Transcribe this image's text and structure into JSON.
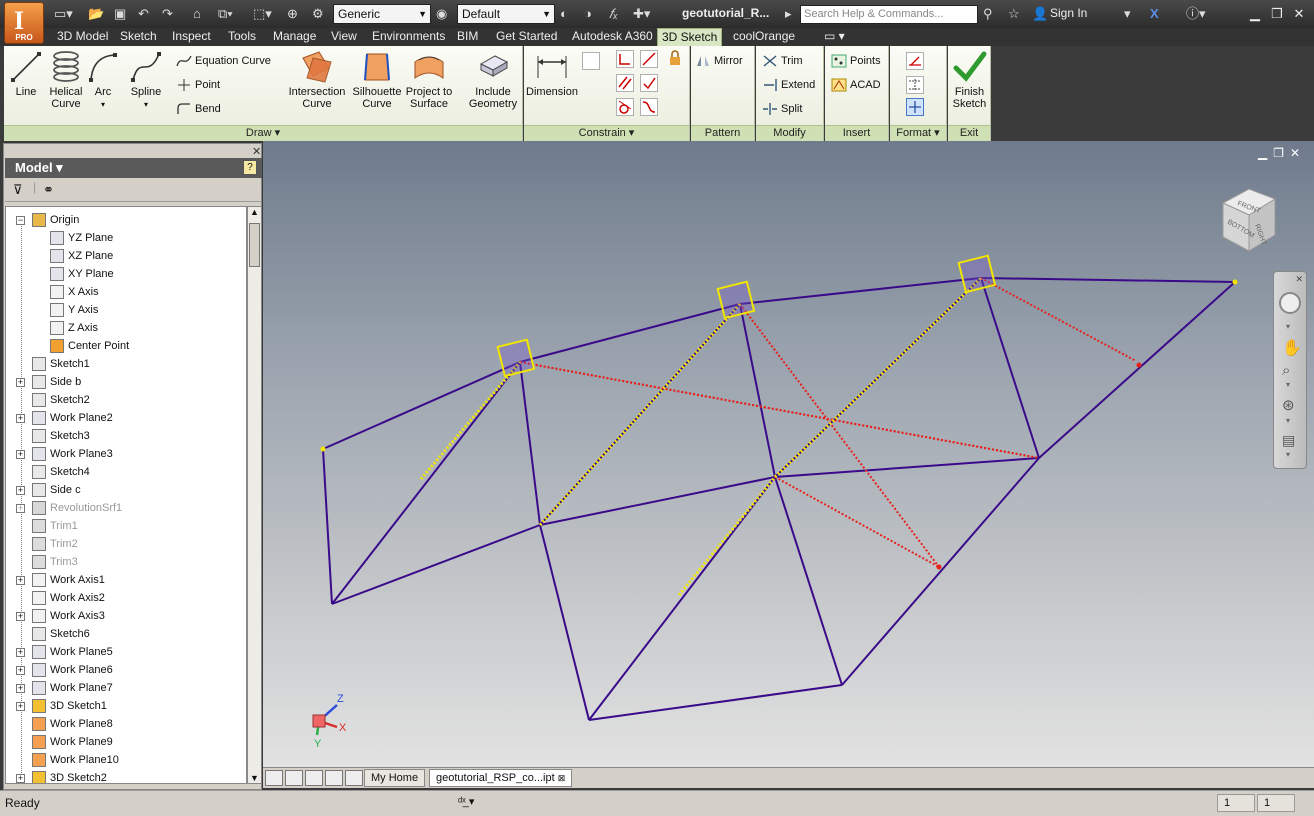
{
  "app": {
    "badge": "PRO",
    "document_title": "geotutorial_R...",
    "search_placeholder": "Search Help & Commands...",
    "sign_in": "Sign In"
  },
  "qat": {
    "material_combo": "Generic",
    "appearance_combo": "Default"
  },
  "menu_tabs": [
    "3D Model",
    "Sketch",
    "Inspect",
    "Tools",
    "Manage",
    "View",
    "Environments",
    "BIM",
    "Get Started",
    "Autodesk A360",
    "3D Sketch",
    "coolOrange"
  ],
  "active_tab": "3D Sketch",
  "ribbon": {
    "draw": {
      "label": "Draw",
      "line": "Line",
      "helical_curve": "Helical\nCurve",
      "arc": "Arc",
      "spline": "Spline",
      "equation_curve": "Equation Curve",
      "point": "Point",
      "bend": "Bend",
      "intersection_curve": "Intersection\nCurve",
      "silhouette_curve": "Silhouette\nCurve",
      "project_to_surface": "Project to\nSurface",
      "include_geometry": "Include\nGeometry"
    },
    "constrain": {
      "label": "Constrain",
      "dimension": "Dimension"
    },
    "pattern": {
      "label": "Pattern",
      "mirror": "Mirror"
    },
    "modify": {
      "label": "Modify",
      "trim": "Trim",
      "extend": "Extend",
      "split": "Split"
    },
    "insert": {
      "label": "Insert",
      "points": "Points",
      "acad": "ACAD"
    },
    "format": {
      "label": "Format"
    },
    "exit": {
      "label": "Exit",
      "finish_sketch": "Finish\nSketch"
    }
  },
  "browser": {
    "title": "Model",
    "help": "?",
    "items": [
      {
        "label": "Origin",
        "indent": 1,
        "expander": "−",
        "icon": "folder-icon",
        "dim": false
      },
      {
        "label": "YZ Plane",
        "indent": 2,
        "icon": "plane-icon",
        "dim": false
      },
      {
        "label": "XZ Plane",
        "indent": 2,
        "icon": "plane-icon",
        "dim": false
      },
      {
        "label": "XY Plane",
        "indent": 2,
        "icon": "plane-icon",
        "dim": false
      },
      {
        "label": "X Axis",
        "indent": 2,
        "icon": "axis-icon",
        "dim": false
      },
      {
        "label": "Y Axis",
        "indent": 2,
        "icon": "axis-icon",
        "dim": false
      },
      {
        "label": "Z Axis",
        "indent": 2,
        "icon": "axis-icon",
        "dim": false
      },
      {
        "label": "Center Point",
        "indent": 2,
        "icon": "center-point-icon",
        "dim": false
      },
      {
        "label": "Sketch1",
        "indent": 1,
        "icon": "sketch-icon",
        "dim": false
      },
      {
        "label": "Side b",
        "indent": 1,
        "expander": "+",
        "icon": "sketch-icon",
        "dim": false
      },
      {
        "label": "Sketch2",
        "indent": 1,
        "icon": "sketch-icon",
        "dim": false
      },
      {
        "label": "Work Plane2",
        "indent": 1,
        "expander": "+",
        "icon": "plane-icon",
        "dim": false
      },
      {
        "label": "Sketch3",
        "indent": 1,
        "icon": "sketch-icon",
        "dim": false
      },
      {
        "label": "Work Plane3",
        "indent": 1,
        "expander": "+",
        "icon": "plane-icon",
        "dim": false
      },
      {
        "label": "Sketch4",
        "indent": 1,
        "icon": "sketch-icon",
        "dim": false
      },
      {
        "label": "Side c",
        "indent": 1,
        "expander": "+",
        "icon": "sketch-icon",
        "dim": false
      },
      {
        "label": "RevolutionSrf1",
        "indent": 1,
        "expander": "+",
        "icon": "revolve-icon",
        "dim": true
      },
      {
        "label": "Trim1",
        "indent": 1,
        "icon": "trim-icon",
        "dim": true
      },
      {
        "label": "Trim2",
        "indent": 1,
        "icon": "trim-icon",
        "dim": true
      },
      {
        "label": "Trim3",
        "indent": 1,
        "icon": "trim-icon",
        "dim": true
      },
      {
        "label": "Work Axis1",
        "indent": 1,
        "expander": "+",
        "icon": "axis-icon",
        "dim": false
      },
      {
        "label": "Work Axis2",
        "indent": 1,
        "icon": "axis-icon",
        "dim": false
      },
      {
        "label": "Work Axis3",
        "indent": 1,
        "expander": "+",
        "icon": "axis-icon",
        "dim": false
      },
      {
        "label": "Sketch6",
        "indent": 1,
        "icon": "sketch-icon",
        "dim": false
      },
      {
        "label": "Work Plane5",
        "indent": 1,
        "expander": "+",
        "icon": "plane-icon",
        "dim": false
      },
      {
        "label": "Work Plane6",
        "indent": 1,
        "expander": "+",
        "icon": "plane-icon",
        "dim": false
      },
      {
        "label": "Work Plane7",
        "indent": 1,
        "expander": "+",
        "icon": "plane-icon",
        "dim": false
      },
      {
        "label": "3D Sketch1",
        "indent": 1,
        "expander": "+",
        "icon": "sketch3d-icon",
        "dim": false
      },
      {
        "label": "Work Plane8",
        "indent": 1,
        "icon": "plane-orange-icon",
        "dim": false
      },
      {
        "label": "Work Plane9",
        "indent": 1,
        "icon": "plane-orange-icon",
        "dim": false
      },
      {
        "label": "Work Plane10",
        "indent": 1,
        "icon": "plane-orange-icon",
        "dim": false
      },
      {
        "label": "3D Sketch2",
        "indent": 1,
        "expander": "+",
        "icon": "sketch3d-icon",
        "dim": false
      }
    ]
  },
  "viewcube": {
    "front": "FRONT",
    "right": "RIGHT",
    "bottom": "BOTTOM"
  },
  "triad": {
    "x": "X",
    "y": "Y",
    "z": "Z"
  },
  "colors": {
    "sketch_line": "#3a0a8a",
    "constraint_yellow": "#f2e600",
    "construction_red": "#e8201a"
  },
  "doc_tabs": {
    "home": "My Home",
    "document": "geotutorial_RSP_co...ipt"
  },
  "status": {
    "text": "Ready",
    "box1": "1",
    "box2": "1"
  }
}
